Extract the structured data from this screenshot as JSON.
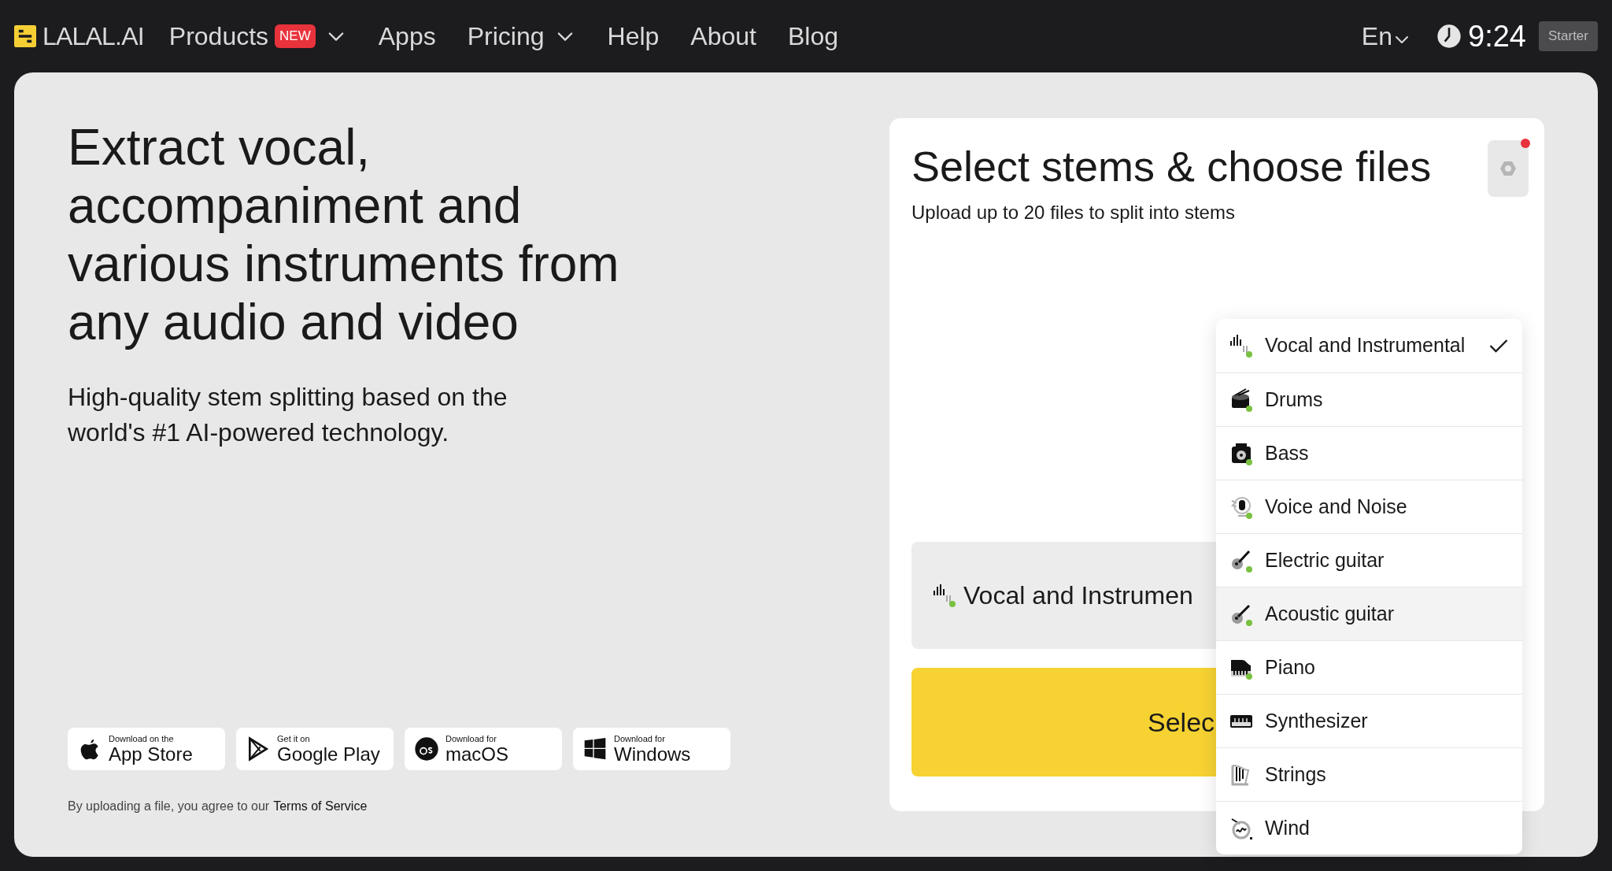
{
  "header": {
    "logo": "LALAL.AI",
    "nav": [
      {
        "label": "Products",
        "badge": "NEW",
        "dropdown": true
      },
      {
        "label": "Apps",
        "dropdown": false
      },
      {
        "label": "Pricing",
        "dropdown": true
      },
      {
        "label": "Help",
        "dropdown": false
      },
      {
        "label": "About",
        "dropdown": false
      },
      {
        "label": "Blog",
        "dropdown": false
      }
    ],
    "language": "En",
    "time": "9:24",
    "plan": "Starter"
  },
  "hero": {
    "title": "Extract vocal, accompaniment and various instruments from any audio and video",
    "subtitle": "High-quality stem splitting based on the world's #1 AI-powered technology.",
    "stores": [
      {
        "small": "Download on the",
        "big": "App Store"
      },
      {
        "small": "Get it on",
        "big": "Google Play"
      },
      {
        "small": "Download for",
        "big": "macOS"
      },
      {
        "small": "Download for",
        "big": "Windows"
      }
    ],
    "terms": {
      "text": "By uploading a file, you agree to our",
      "link": "Terms of Service"
    }
  },
  "card": {
    "title": "Select stems & choose files",
    "subtitle": "Upload up to 20 files to split into stems",
    "settings_notification": true,
    "stem_select": "Vocal and Instrumen",
    "upload_button": "Selec"
  },
  "dropdown": [
    {
      "label": "Vocal and Instrumental",
      "selected": true,
      "highlighted": false,
      "status_dot": true
    },
    {
      "label": "Drums",
      "selected": false,
      "highlighted": false,
      "status_dot": true
    },
    {
      "label": "Bass",
      "selected": false,
      "highlighted": false,
      "status_dot": true
    },
    {
      "label": "Voice and Noise",
      "selected": false,
      "highlighted": false,
      "status_dot": true
    },
    {
      "label": "Electric guitar",
      "selected": false,
      "highlighted": false,
      "status_dot": true
    },
    {
      "label": "Acoustic guitar",
      "selected": false,
      "highlighted": true,
      "status_dot": true
    },
    {
      "label": "Piano",
      "selected": false,
      "highlighted": false,
      "status_dot": true
    },
    {
      "label": "Synthesizer",
      "selected": false,
      "highlighted": false,
      "status_dot": false
    },
    {
      "label": "Strings",
      "selected": false,
      "highlighted": false,
      "status_dot": false
    },
    {
      "label": "Wind",
      "selected": false,
      "highlighted": false,
      "status_dot": false
    }
  ]
}
